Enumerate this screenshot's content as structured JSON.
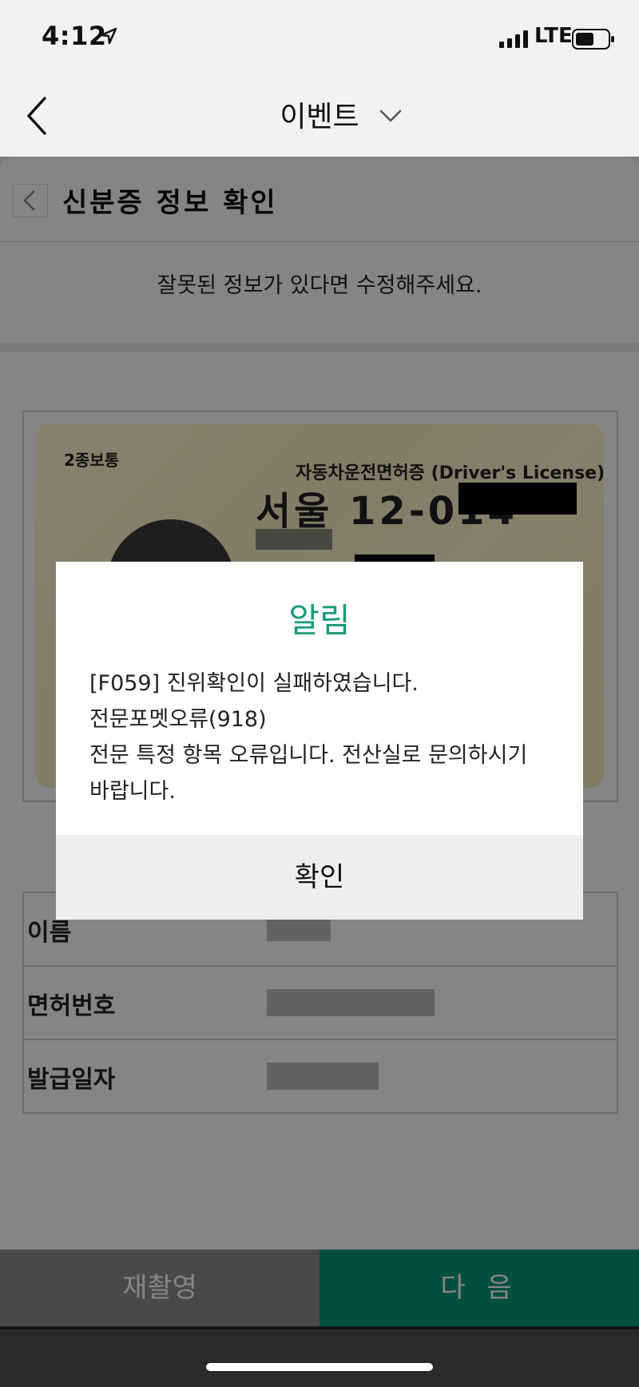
{
  "status_bar": {
    "time": "4:12",
    "network": "LTE"
  },
  "nav": {
    "title": "이벤트"
  },
  "sheet": {
    "title": "신분증 정보 확인",
    "notice": "잘못된 정보가 있다면 수정해주세요."
  },
  "card": {
    "type": "2종보통",
    "header": "자동차운전면허증 (Driver's License)",
    "region": "서울 12-014"
  },
  "fields": [
    {
      "label": "이름"
    },
    {
      "label": "면허번호"
    },
    {
      "label": "발급일자"
    }
  ],
  "buttons": {
    "retake": "재촬영",
    "next": "다 음"
  },
  "dialog": {
    "title": "알림",
    "lines": [
      "[F059] 진위확인이 실패하였습니다.",
      "전문포멧오류(918)",
      "전문 특정 항목 오류입니다. 전산실로 문의하시기",
      "바랍니다."
    ],
    "confirm": "확인",
    "accent_color": "#1a9a78"
  },
  "colors": {
    "next_button": "#009a75"
  }
}
